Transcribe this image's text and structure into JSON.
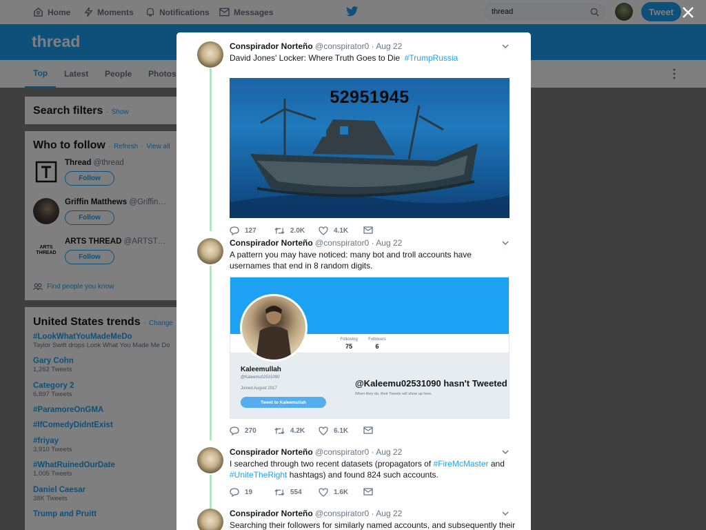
{
  "nav": {
    "home": "Home",
    "moments": "Moments",
    "notifications": "Notifications",
    "messages": "Messages",
    "search_value": "thread",
    "tweet_label": "Tweet"
  },
  "banner": {
    "title": "thread"
  },
  "tabs": [
    "Top",
    "Latest",
    "People",
    "Photos"
  ],
  "search_filters": {
    "title": "Search filters",
    "sep": "·",
    "show": "Show"
  },
  "who_to_follow": {
    "title": "Who to follow",
    "sep": "·",
    "refresh": "Refresh",
    "view_all": "View all",
    "follow_label": "Follow",
    "users": [
      {
        "name": "Thread",
        "handle": "@thread"
      },
      {
        "name": "Griffin Matthews",
        "handle": "@Griffin…"
      },
      {
        "name": "ARTS THREAD",
        "handle": "@ARTST…",
        "logo_text": "ARTS THREAD"
      }
    ],
    "find_people": "Find people you know"
  },
  "trends": {
    "title": "United States trends",
    "sep": "·",
    "change": "Change",
    "items": [
      {
        "name": "#LookWhatYouMadeMeDo",
        "sub": "Taylor Swift drops Look What You Made Me Do"
      },
      {
        "name": "Gary Cohn",
        "sub": "1,262 Tweets"
      },
      {
        "name": "Category 2",
        "sub": "6,897 Tweets"
      },
      {
        "name": "#ParamoreOnGMA",
        "sub": ""
      },
      {
        "name": "#IfComedyDidntExist",
        "sub": ""
      },
      {
        "name": "#friyay",
        "sub": "3,910 Tweets"
      },
      {
        "name": "#WhatRuinedOurDate",
        "sub": "1,005 Tweets"
      },
      {
        "name": "Daniel Caesar",
        "sub": "38K Tweets"
      },
      {
        "name": "Trump and Pruitt",
        "sub": ""
      }
    ]
  },
  "tweets": [
    {
      "name": "Conspirador Norteño",
      "meta": "@conspirator0 · Aug 22",
      "text": "David Jones' Locker: Where Truth Goes to Die",
      "hashtag": "#TrumpRussia",
      "media_number": "52951945",
      "replies": "127",
      "retweets": "2.0K",
      "likes": "4.1K"
    },
    {
      "name": "Conspirador Norteño",
      "meta": "@conspirator0 · Aug 22",
      "text": "A pattern you may have noticed: many bot and troll accounts have usernames that end in 8 random digits.",
      "media": {
        "following_label": "Following",
        "following": "75",
        "followers_label": "Followers",
        "followers": "6",
        "name": "Kaleemullah",
        "handle": "@Kaleemu02531090",
        "joined": "Joined August 2017",
        "button": "Tweet to Kaleemullah",
        "big_text": "@Kaleemu02531090 hasn't Tweeted",
        "sub_text": "When they do, their Tweets will show up here."
      },
      "replies": "270",
      "retweets": "4.2K",
      "likes": "6.1K"
    },
    {
      "name": "Conspirador Norteño",
      "meta": "@conspirator0 · Aug 22",
      "text_a": "I searched through two recent datasets (propagators of",
      "hashtag_a": "#FireMcMaster",
      "text_b": "and",
      "hashtag_b": "#UniteTheRight",
      "text_c": "hashtags) and found 824 such accounts.",
      "replies": "19",
      "retweets": "554",
      "likes": "1.6K"
    },
    {
      "name": "Conspirador Norteño",
      "meta": "@conspirator0 · Aug 22",
      "text": "Searching their followers for similarly named accounts, and subsequently their"
    }
  ],
  "colors": {
    "accent": "#1da1f2",
    "thread_line": "#b4e3c3"
  }
}
